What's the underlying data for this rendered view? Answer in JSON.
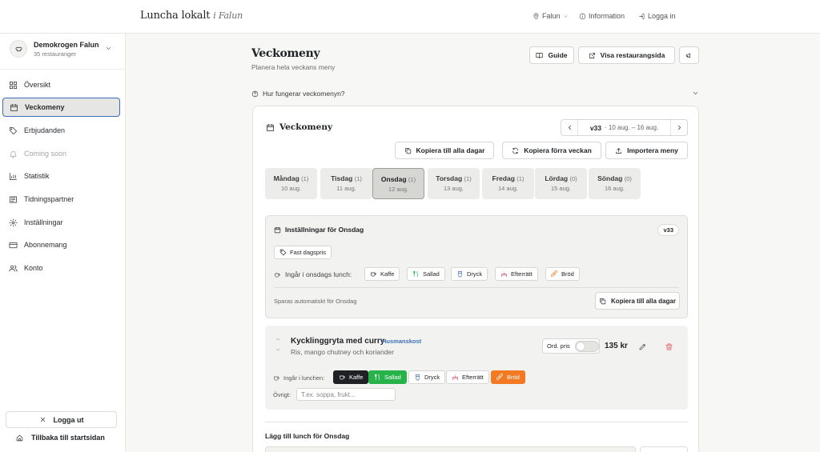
{
  "topbar": {
    "brand": "Luncha lokalt",
    "brand_city": "i Falun",
    "city_label": "Falun",
    "info_label": "Information",
    "login_label": "Logga in"
  },
  "sidebar": {
    "org_name": "Demokrogen Falun",
    "org_count": "35 restauranger",
    "items": [
      {
        "label": "Översikt",
        "icon": "grid-icon",
        "state": "normal"
      },
      {
        "label": "Veckomeny",
        "icon": "calendar-icon",
        "state": "active"
      },
      {
        "label": "Erbjudanden",
        "icon": "tag-icon",
        "state": "normal"
      },
      {
        "label": "Coming soon",
        "icon": "bell-icon",
        "state": "disabled"
      },
      {
        "label": "Statistik",
        "icon": "chart-icon",
        "state": "normal"
      },
      {
        "label": "Tidningspartner",
        "icon": "newspaper-icon",
        "state": "normal"
      },
      {
        "label": "Inställningar",
        "icon": "gear-icon",
        "state": "normal"
      },
      {
        "label": "Abonnemang",
        "icon": "card-icon",
        "state": "normal"
      },
      {
        "label": "Konto",
        "icon": "users-icon",
        "state": "normal"
      }
    ],
    "logout_label": "Logga ut",
    "back_label": "Tillbaka till startsidan"
  },
  "header": {
    "title": "Veckomeny",
    "subtitle": "Planera hela veckans meny",
    "guide_label": "Guide",
    "visit_label": "Visa restaurangsida",
    "howto_label": "Hur fungerar veckomenyn?"
  },
  "week": {
    "card_title": "Veckomeny",
    "week_label": "v33",
    "range": "· 10 aug. – 16 aug.",
    "copy_all_label": "Kopiera till alla dagar",
    "copy_prev_label": "Kopiera förra veckan",
    "import_label": "Importera meny",
    "days": [
      {
        "name": "Måndag",
        "count": "(1)",
        "date": "10 aug."
      },
      {
        "name": "Tisdag",
        "count": "(1)",
        "date": "11 aug."
      },
      {
        "name": "Onsdag",
        "count": "(1)",
        "date": "12 aug."
      },
      {
        "name": "Torsdag",
        "count": "(1)",
        "date": "13 aug."
      },
      {
        "name": "Fredag",
        "count": "(1)",
        "date": "14 aug."
      },
      {
        "name": "Lördag",
        "count": "(0)",
        "date": "15 aug."
      },
      {
        "name": "Söndag",
        "count": "(0)",
        "date": "16 aug."
      }
    ],
    "selected_day": "Onsdag"
  },
  "settings": {
    "title": "Inställningar för Onsdag",
    "week_badge": "v33",
    "fixed_price_label": "Fast dagspris",
    "includes_label": "Ingår i onsdags lunch:",
    "includes": [
      "Kaffe",
      "Sallad",
      "Dryck",
      "Efterrätt",
      "Bröd"
    ],
    "autosave_label": "Sparas automatiskt för Onsdag",
    "copy_all_label": "Kopiera till alla dagar"
  },
  "item": {
    "name": "Kycklinggryta med curry",
    "tag": "Husmanskost",
    "description": "Ris, mango chutney och koriander",
    "ord_pris_label": "Ord. pris",
    "price": "135 kr",
    "includes_label": "Ingår i lunchen:",
    "includes": [
      {
        "label": "Kaffe",
        "active": true,
        "color": "#1f2124"
      },
      {
        "label": "Sallad",
        "active": true,
        "color": "#27b24a"
      },
      {
        "label": "Dryck",
        "active": false,
        "color": "#ffffff"
      },
      {
        "label": "Efterrätt",
        "active": false,
        "color": "#ffffff"
      },
      {
        "label": "Bröd",
        "active": true,
        "color": "#f37a22"
      }
    ],
    "other_label": "Övrigt:",
    "other_placeholder": "T.ex. soppa, frukt..."
  },
  "add": {
    "title": "Lägg till lunch för Onsdag"
  }
}
